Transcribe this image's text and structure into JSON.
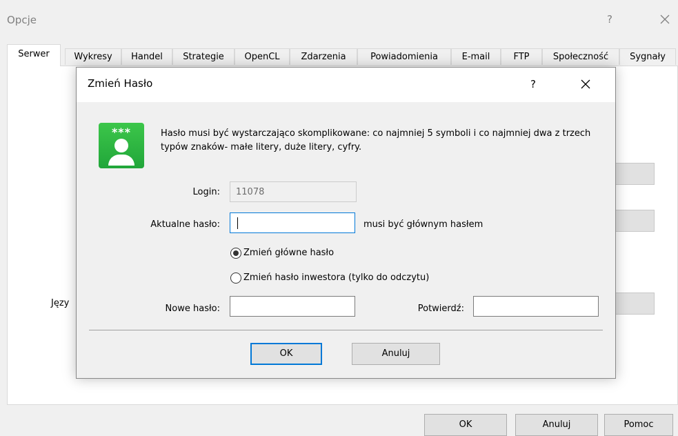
{
  "outer": {
    "title": "Opcje",
    "help": "?",
    "tabs": [
      "Serwer",
      "Wykresy",
      "Handel",
      "Strategie",
      "OpenCL",
      "Zdarzenia",
      "Powiadomienia",
      "E-mail",
      "FTP",
      "Społeczność",
      "Sygnały"
    ],
    "language_label_partial": "Języ",
    "buttons": {
      "ok": "OK",
      "cancel": "Anuluj",
      "help": "Pomoc"
    }
  },
  "dialog": {
    "title": "Zmień Hasło",
    "help": "?",
    "icon_stars": "***",
    "message": "Hasło musi być wystarczająco skomplikowane: co najmniej 5 symboli i co najmniej dwa z trzech typów znaków- małe litery, duże litery, cyfry.",
    "login_label": "Login:",
    "login_value": "11078",
    "current_password_label": "Aktualne hasło:",
    "current_password_value": "",
    "current_password_hint": "musi być głównym hasłem",
    "radio_main": "Zmień główne hasło",
    "radio_investor": "Zmień hasło inwestora (tylko do odczytu)",
    "radio_selected": "main",
    "new_password_label": "Nowe hasło:",
    "new_password_value": "",
    "confirm_label": "Potwierdź:",
    "confirm_value": "",
    "ok_label": "OK",
    "cancel_label": "Anuluj"
  },
  "colors": {
    "accent": "#0078d7",
    "icon_green": "#21a63a"
  }
}
